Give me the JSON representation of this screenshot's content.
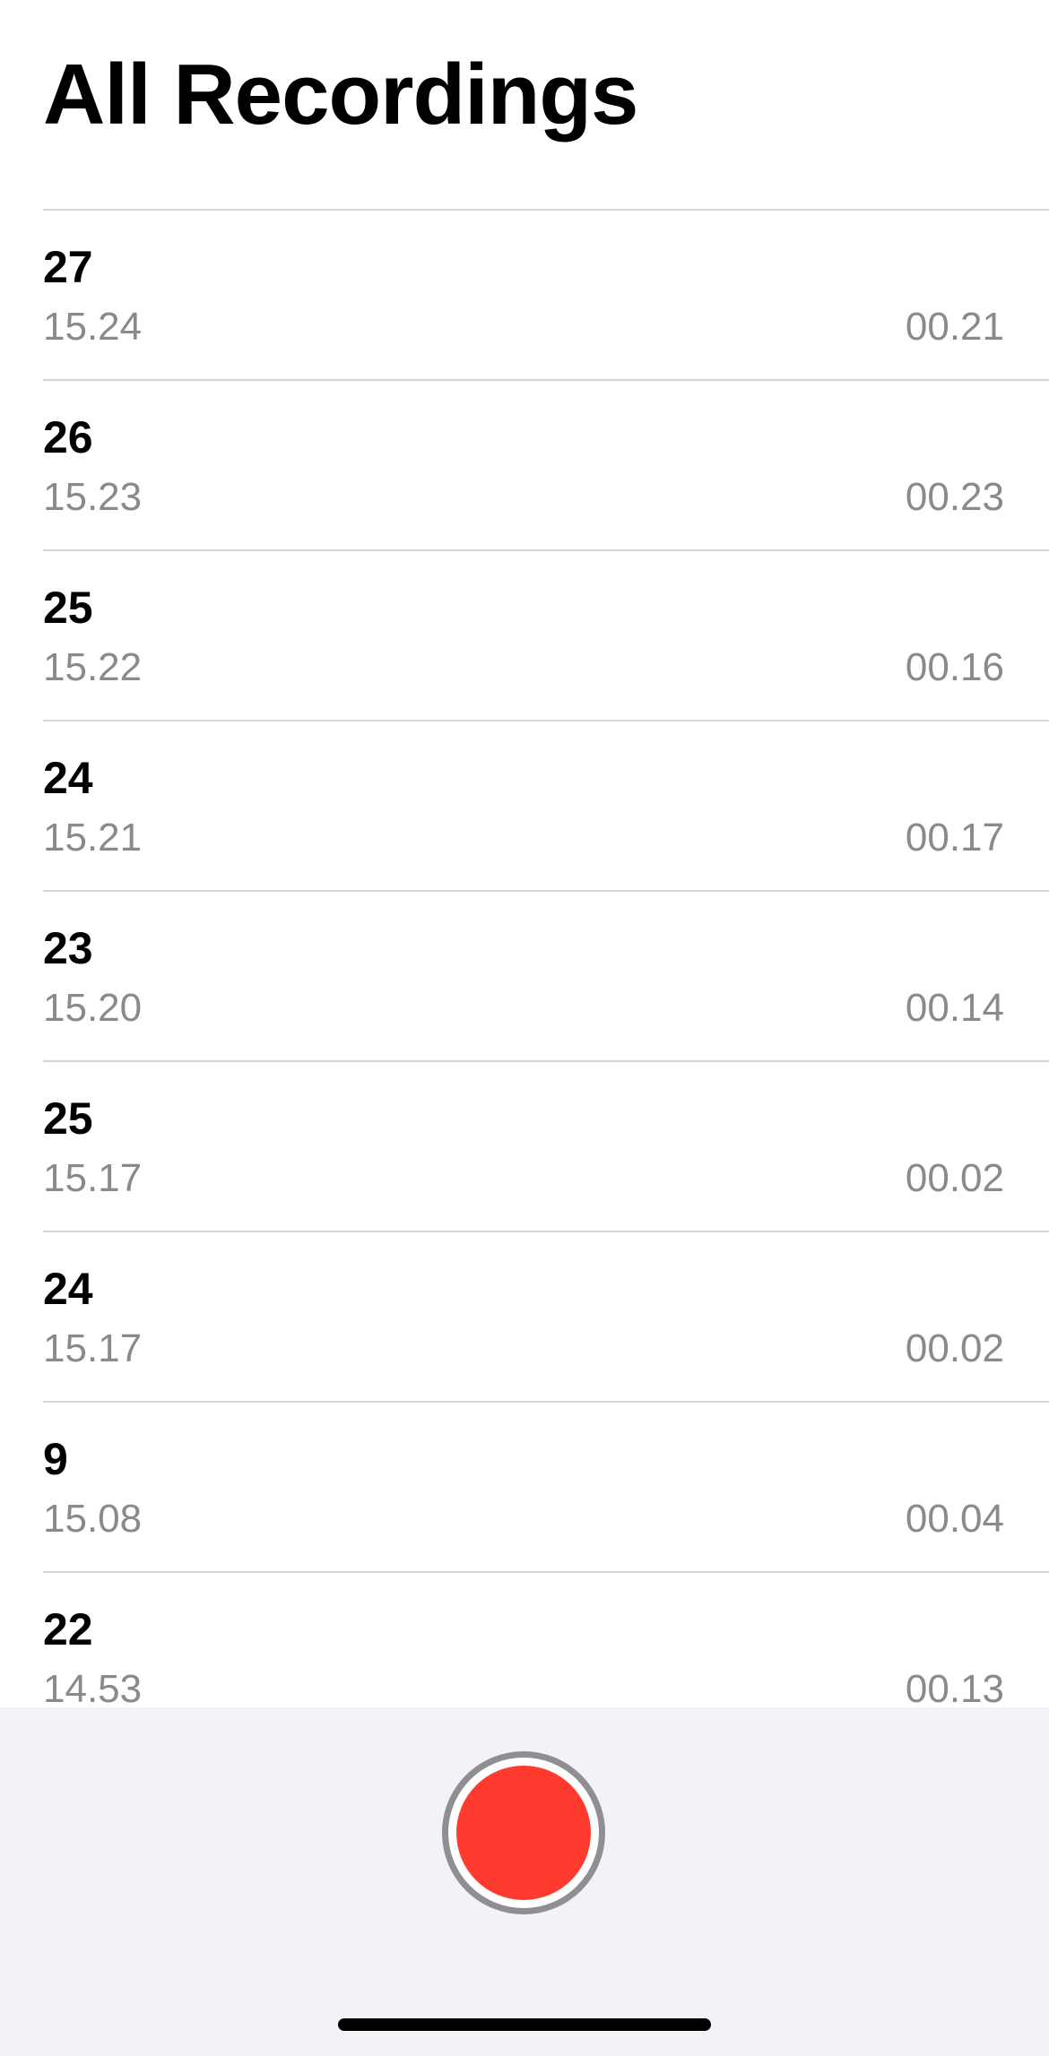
{
  "header": {
    "title": "All Recordings"
  },
  "recordings": [
    {
      "name": "27",
      "time": "15.24",
      "duration": "00.21"
    },
    {
      "name": "26",
      "time": "15.23",
      "duration": "00.23"
    },
    {
      "name": "25",
      "time": "15.22",
      "duration": "00.16"
    },
    {
      "name": "24",
      "time": "15.21",
      "duration": "00.17"
    },
    {
      "name": "23",
      "time": "15.20",
      "duration": "00.14"
    },
    {
      "name": "25",
      "time": "15.17",
      "duration": "00.02"
    },
    {
      "name": "24",
      "time": "15.17",
      "duration": "00.02"
    },
    {
      "name": "9",
      "time": "15.08",
      "duration": "00.04"
    },
    {
      "name": "22",
      "time": "14.53",
      "duration": "00.13"
    }
  ],
  "record_button": {
    "icon": "record-icon",
    "color": "#ff3b30"
  },
  "colors": {
    "background": "#ffffff",
    "toolbar_background": "#f2f2f7",
    "secondary_text": "#8a8a8e",
    "separator": "#d6d6d8"
  }
}
